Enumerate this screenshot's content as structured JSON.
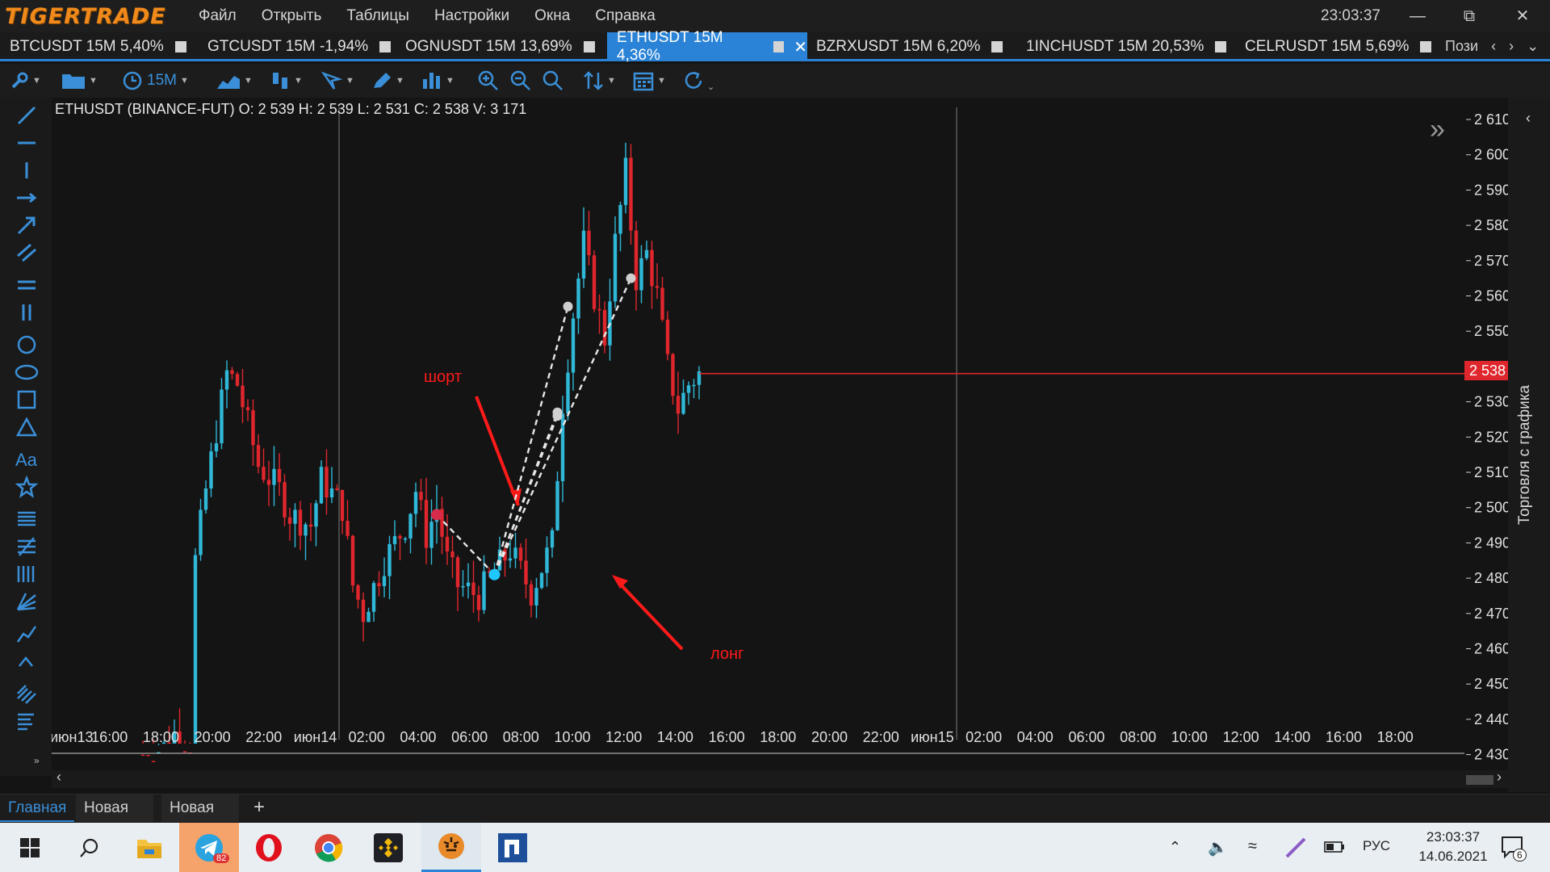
{
  "app": {
    "logo": "TIGERTRADE",
    "menu": [
      "Файл",
      "Открыть",
      "Таблицы",
      "Настройки",
      "Окна",
      "Справка"
    ],
    "clock": "23:03:37"
  },
  "tabs": [
    {
      "label": "BTCUSDT 15M 5,40%",
      "active": false
    },
    {
      "label": "GTCUSDT 15M -1,94%",
      "active": false
    },
    {
      "label": "OGNUSDT 15M 13,69%",
      "active": false
    },
    {
      "label": "ETHUSDT 15M 4,36%",
      "active": true
    },
    {
      "label": "BZRXUSDT 15M 6,20%",
      "active": false
    },
    {
      "label": "1INCHUSDT 15M 20,53%",
      "active": false
    },
    {
      "label": "CELRUSDT 15M 5,69%",
      "active": false
    }
  ],
  "tab_overflow": "Пози",
  "toolbar": {
    "timeframe": "15M"
  },
  "chart": {
    "ohlc_label": "ETHUSDT (BINANCE-FUT)  O: 2 539  H: 2 539  L: 2 531  C: 2 538  V: 3 171",
    "current_price": "2 538",
    "price_labels": [
      "2 610",
      "2 600",
      "2 590",
      "2 580",
      "2 570",
      "2 560",
      "2 550",
      "2 540",
      "2 530",
      "2 520",
      "2 510",
      "2 500",
      "2 490",
      "2 480",
      "2 470",
      "2 460",
      "2 450",
      "2 440",
      "2 430"
    ],
    "time_labels": [
      "июн13",
      "16:00",
      "18:00",
      "20:00",
      "22:00",
      "июн14",
      "02:00",
      "04:00",
      "06:00",
      "08:00",
      "10:00",
      "12:00",
      "14:00",
      "16:00",
      "18:00",
      "20:00",
      "22:00",
      "июн15",
      "02:00",
      "04:00",
      "06:00",
      "08:00",
      "10:00",
      "12:00",
      "14:00",
      "16:00",
      "18:00"
    ],
    "annotation_short": "шорт",
    "annotation_long": "лонг",
    "colors": {
      "bull": "#2fb8d8",
      "bear": "#e0262d",
      "price_line": "#e0262d",
      "grid": "#3a3a3a",
      "annotation": "#ff1a1a"
    }
  },
  "chart_data": {
    "type": "candlestick",
    "symbol": "ETHUSDT",
    "exchange": "BINANCE-FUT",
    "timeframe": "15M",
    "ylim": [
      2425,
      2615
    ],
    "last": {
      "open": 2539,
      "high": 2539,
      "low": 2531,
      "close": 2538,
      "volume": 3171
    },
    "segments": [
      [
        "июн13 17:30",
        2430
      ],
      [
        "июн13 18:30",
        2432
      ],
      [
        "июн13 19:00",
        2436
      ],
      [
        "июн13 19:45",
        2433
      ],
      [
        "июн13 20:00",
        2485
      ],
      [
        "июн13 20:30",
        2505
      ],
      [
        "июн13 21:00",
        2522
      ],
      [
        "июн13 21:30",
        2538
      ],
      [
        "июн13 22:00",
        2535
      ],
      [
        "июн13 23:00",
        2512
      ],
      [
        "июн14 00:00",
        2505
      ],
      [
        "июн14 00:30",
        2498
      ],
      [
        "июн14 01:30",
        2495
      ],
      [
        "июн14 02:00",
        2508
      ],
      [
        "июн14 03:00",
        2500
      ],
      [
        "июн14 03:30",
        2478
      ],
      [
        "июн14 04:00",
        2470
      ],
      [
        "июн14 05:00",
        2485
      ],
      [
        "июн14 06:00",
        2495
      ],
      [
        "июн14 06:30",
        2505
      ],
      [
        "июн14 07:00",
        2492
      ],
      [
        "июн14 07:30",
        2500
      ],
      [
        "июн14 08:00",
        2485
      ],
      [
        "июн14 08:30",
        2478
      ],
      [
        "июн14 09:30",
        2475
      ],
      [
        "июн14 10:00",
        2480
      ],
      [
        "июн14 11:00",
        2488
      ],
      [
        "июн14 12:00",
        2476
      ],
      [
        "июн14 13:00",
        2490
      ],
      [
        "июн14 13:30",
        2530
      ],
      [
        "июн14 14:00",
        2555
      ],
      [
        "июн14 14:30",
        2575
      ],
      [
        "июн14 15:00",
        2560
      ],
      [
        "июн14 15:30",
        2548
      ],
      [
        "июн14 16:00",
        2575
      ],
      [
        "июн14 16:30",
        2595
      ],
      [
        "июн14 17:00",
        2565
      ],
      [
        "июн14 17:30",
        2572
      ],
      [
        "июн14 18:00",
        2560
      ],
      [
        "июн14 18:30",
        2540
      ],
      [
        "июн14 19:00",
        2528
      ],
      [
        "июн14 19:30",
        2535
      ],
      [
        "июн14 20:00",
        2538
      ]
    ],
    "annotations": [
      {
        "label": "шорт",
        "time": "июн14 07:30",
        "price": 2498
      },
      {
        "label": "лонг",
        "time": "июн14 10:15",
        "price": 2481
      }
    ],
    "lines": [
      {
        "from": [
          "июн14 07:30",
          2498
        ],
        "to": [
          "июн14 10:15",
          2481
        ]
      },
      {
        "from": [
          "июн14 10:15",
          2481
        ],
        "to": [
          "июн14 13:45",
          2557
        ]
      },
      {
        "from": [
          "июн14 10:15",
          2481
        ],
        "to": [
          "июн14 13:15",
          2527
        ]
      },
      {
        "from": [
          "июн14 10:15",
          2481
        ],
        "to": [
          "июн14 13:15",
          2526
        ]
      },
      {
        "from": [
          "июн14 10:15",
          2481
        ],
        "to": [
          "июн14 16:45",
          2565
        ]
      }
    ]
  },
  "sidebar": {
    "trade_label": "Торговля с графика"
  },
  "workspace_tabs": [
    "Главная",
    "Новая",
    "Новая"
  ],
  "taskbar": {
    "telegram_badge": "82",
    "lang": "РУС",
    "time": "23:03:37",
    "date": "14.06.2021",
    "notify_count": "6"
  }
}
